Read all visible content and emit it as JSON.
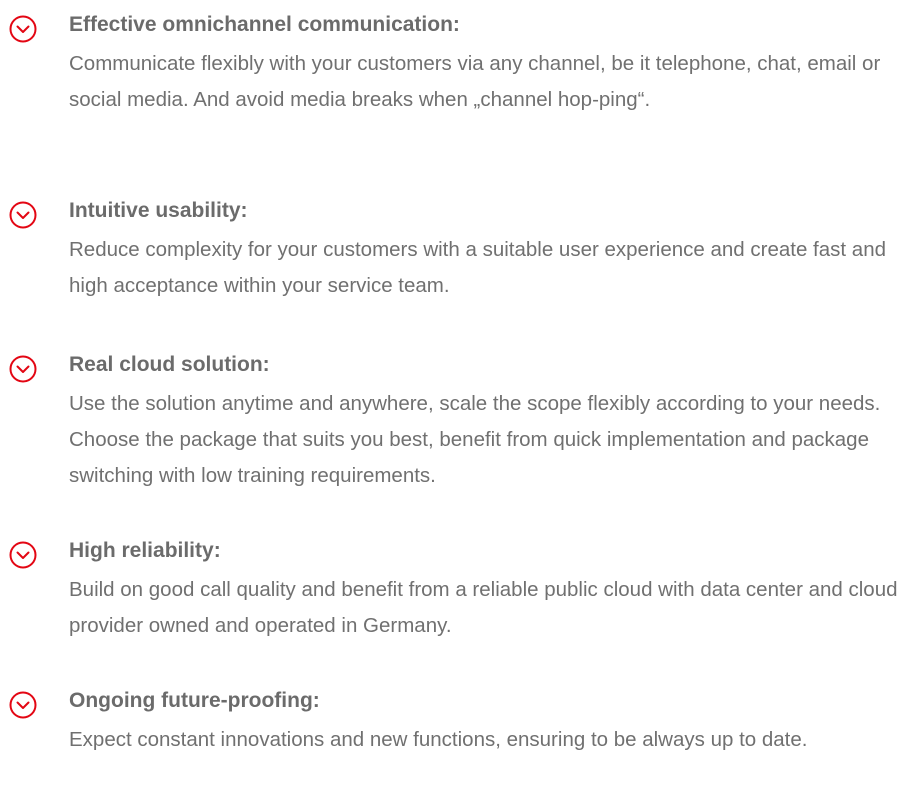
{
  "accent_color": "#e30613",
  "features": [
    {
      "icon": "chevron-down-circle-icon",
      "title": "Effective omnichannel communication:",
      "description": "Communicate flexibly with your customers via any channel, be it telephone, chat, email or social media. And avoid media breaks when „channel hop-ping“."
    },
    {
      "icon": "chevron-down-circle-icon",
      "title": "Intuitive usability:",
      "description": "Reduce complexity for your customers with a suitable user experience and create fast and high acceptance within your service team."
    },
    {
      "icon": "chevron-down-circle-icon",
      "title": "Real cloud solution:",
      "description": "Use the solution anytime and anywhere, scale the scope flexibly according to your needs. Choose the package that suits you best, benefit from quick implementation and package switching with low training requirements."
    },
    {
      "icon": "chevron-down-circle-icon",
      "title": "High reliability:",
      "description": "Build on good call quality and benefit from a reliable public cloud with data center and cloud provider owned and operated in Germany."
    },
    {
      "icon": "chevron-down-circle-icon",
      "title": "Ongoing future-proofing:",
      "description": "Expect constant innovations and new functions, ensuring to be always up to date."
    }
  ]
}
